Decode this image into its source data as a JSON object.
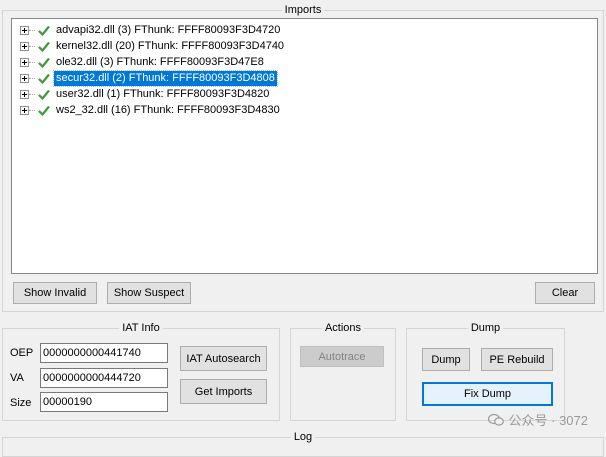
{
  "imports": {
    "title": "Imports",
    "items": [
      {
        "label": "advapi32.dll (3) FThunk: FFFF80093F3D4720",
        "selected": false
      },
      {
        "label": "kernel32.dll (20) FThunk: FFFF80093F3D4740",
        "selected": false
      },
      {
        "label": "ole32.dll (3) FThunk: FFFF80093F3D47E8",
        "selected": false
      },
      {
        "label": "secur32.dll (2) FThunk: FFFF80093F3D4808",
        "selected": true
      },
      {
        "label": "user32.dll (1) FThunk: FFFF80093F3D4820",
        "selected": false
      },
      {
        "label": "ws2_32.dll (16) FThunk: FFFF80093F3D4830",
        "selected": false
      }
    ],
    "show_invalid": "Show Invalid",
    "show_suspect": "Show Suspect",
    "clear": "Clear"
  },
  "iat_info": {
    "title": "IAT Info",
    "oep_label": "OEP",
    "oep_value": "0000000000441740",
    "va_label": "VA",
    "va_value": "0000000000444720",
    "size_label": "Size",
    "size_value": "00000190",
    "autosearch": "IAT Autosearch",
    "get_imports": "Get Imports"
  },
  "actions": {
    "title": "Actions",
    "autotrace": "Autotrace"
  },
  "dump": {
    "title": "Dump",
    "dump_label": "Dump",
    "pe_rebuild": "PE Rebuild",
    "fix_dump": "Fix Dump"
  },
  "log": {
    "title": "Log"
  },
  "watermark": "公众号 · 3072",
  "colors": {
    "selection": "#0078d7",
    "check": "#3f9b3a"
  }
}
